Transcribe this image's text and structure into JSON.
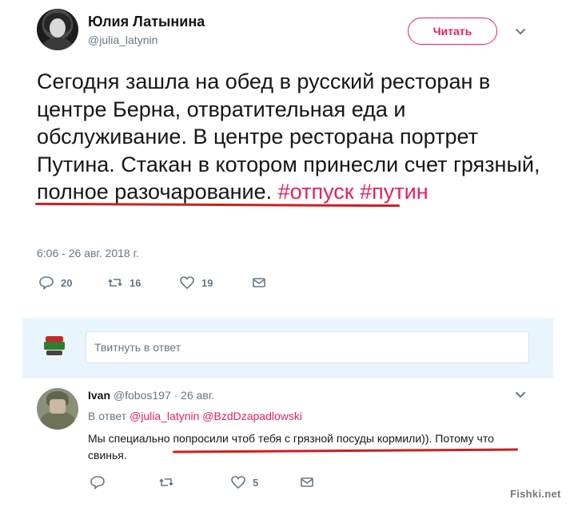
{
  "tweet": {
    "author_name": "Юлия Латынина",
    "author_handle": "@julia_latynin",
    "follow_label": "Читать",
    "text_plain": "Сегодня зашла на обед в русский ресторан в центре Берна, отвратительная еда и обслуживание. В центре ресторана портрет Путина. Стакан в котором принесли счет грязный, полное разочарование. ",
    "hashtag_1": "#отпуск",
    "hashtag_2": "#путин",
    "timestamp": "6:06 - 26 авг. 2018 г.",
    "actions": {
      "replies": "20",
      "retweets": "16",
      "likes": "19"
    }
  },
  "reply_box": {
    "placeholder": "Твитнуть в ответ"
  },
  "reply": {
    "author_name": "Ivan",
    "author_handle": "@fobos197",
    "date": "· 26 авг.",
    "reply_to_prefix": "В ответ",
    "reply_to_mentions": "@julia_latynin @BzdDzapadlowski",
    "text": "Мы специально попросили чтоб тебя с грязной посуды кормили)). Потому что свинья.",
    "actions": {
      "replies": "",
      "retweets": "",
      "likes": "5"
    }
  },
  "watermark": "Fishki.net",
  "colors": {
    "accent": "#e0245e",
    "text": "#14171a",
    "muted": "#657786",
    "underline": "#cc1f1f"
  }
}
